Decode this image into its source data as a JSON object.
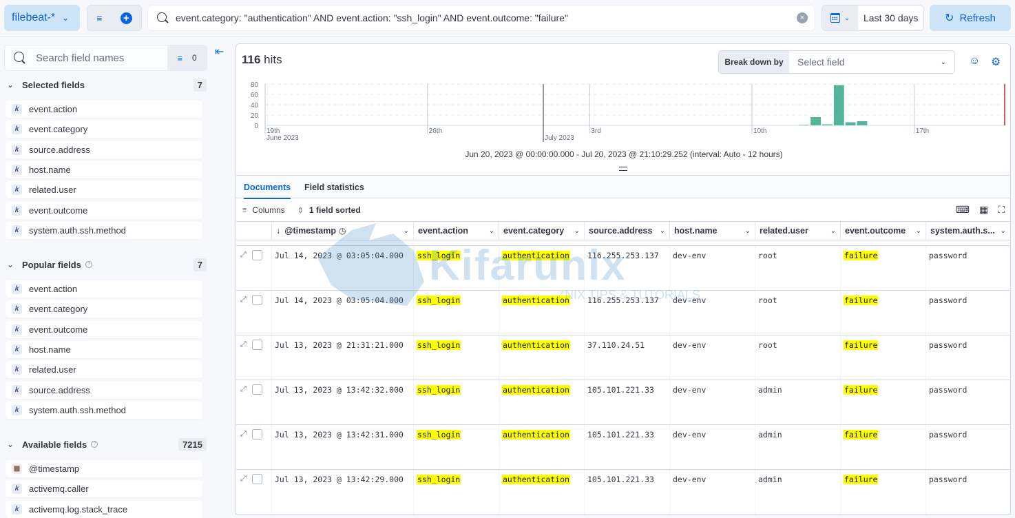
{
  "topbar": {
    "data_view": "filebeat-*",
    "query": "event.category: \"authentication\" AND event.action: \"ssh_login\" AND event.outcome: \"failure\"",
    "time_range_label": "Last 30 days",
    "refresh_label": "Refresh"
  },
  "sidebar": {
    "search_placeholder": "Search field names",
    "filter_count": "0",
    "selected": {
      "title": "Selected fields",
      "count": "7",
      "items": [
        {
          "type": "k",
          "name": "event.action"
        },
        {
          "type": "k",
          "name": "event.category"
        },
        {
          "type": "k",
          "name": "source.address"
        },
        {
          "type": "k",
          "name": "host.name"
        },
        {
          "type": "k",
          "name": "related.user"
        },
        {
          "type": "k",
          "name": "event.outcome"
        },
        {
          "type": "k",
          "name": "system.auth.ssh.method"
        }
      ]
    },
    "popular": {
      "title": "Popular fields",
      "count": "7",
      "items": [
        {
          "type": "k",
          "name": "event.action"
        },
        {
          "type": "k",
          "name": "event.category"
        },
        {
          "type": "k",
          "name": "event.outcome"
        },
        {
          "type": "k",
          "name": "host.name"
        },
        {
          "type": "k",
          "name": "related.user"
        },
        {
          "type": "k",
          "name": "source.address"
        },
        {
          "type": "k",
          "name": "system.auth.ssh.method"
        }
      ]
    },
    "available": {
      "title": "Available fields",
      "count": "7215",
      "items": [
        {
          "type": "date",
          "name": "@timestamp"
        },
        {
          "type": "k",
          "name": "activemq.caller"
        },
        {
          "type": "k",
          "name": "activemq.log.stack_trace"
        }
      ]
    }
  },
  "main": {
    "hits_count": "116",
    "hits_label": "hits",
    "breakdown_label": "Break down by",
    "breakdown_placeholder": "Select field",
    "time_range_text": "Jun 20, 2023 @ 00:00:00.000 - Jul 20, 2023 @ 21:10:29.252 (interval: Auto - 12 hours)",
    "tabs": [
      {
        "label": "Documents",
        "active": true
      },
      {
        "label": "Field statistics",
        "active": false
      }
    ],
    "columns_label": "Columns",
    "sorted_label": "1 field sorted"
  },
  "chart_data": {
    "type": "bar",
    "title": "",
    "xlabel": "",
    "ylabel": "",
    "ylim": [
      0,
      80
    ],
    "y_ticks": [
      "0",
      "20",
      "40",
      "60",
      "80"
    ],
    "x_tick_labels": [
      {
        "label": "19th",
        "sub": "June 2023"
      },
      {
        "label": "26th",
        "sub": ""
      },
      {
        "label": "",
        "sub": "July 2023"
      },
      {
        "label": "3rd",
        "sub": ""
      },
      {
        "label": "10th",
        "sub": ""
      },
      {
        "label": "17th",
        "sub": ""
      }
    ],
    "interval": "12 hours",
    "categories": [
      "Jul 12 00:00",
      "Jul 12 12:00",
      "Jul 13 00:00",
      "Jul 13 12:00",
      "Jul 14 00:00",
      "Jul 14 12:00"
    ],
    "values": [
      1,
      16,
      2,
      78,
      6,
      8
    ],
    "series_color": "#54b399",
    "grid": true,
    "legend": "none"
  },
  "table": {
    "headers": [
      "@timestamp",
      "event.action",
      "event.category",
      "source.address",
      "host.name",
      "related.user",
      "event.outcome",
      "system.auth.s..."
    ],
    "rows": [
      {
        "timestamp": "Jul 14, 2023 @ 03:05:04.000",
        "action": "ssh_login",
        "category": "authentication",
        "source": "116.255.253.137",
        "host": "dev-env",
        "user": "root",
        "outcome": "failure",
        "method": "password"
      },
      {
        "timestamp": "Jul 14, 2023 @ 03:05:04.000",
        "action": "ssh_login",
        "category": "authentication",
        "source": "116.255.253.137",
        "host": "dev-env",
        "user": "root",
        "outcome": "failure",
        "method": "password"
      },
      {
        "timestamp": "Jul 13, 2023 @ 21:31:21.000",
        "action": "ssh_login",
        "category": "authentication",
        "source": "37.110.24.51",
        "host": "dev-env",
        "user": "root",
        "outcome": "failure",
        "method": "password"
      },
      {
        "timestamp": "Jul 13, 2023 @ 13:42:32.000",
        "action": "ssh_login",
        "category": "authentication",
        "source": "105.101.221.33",
        "host": "dev-env",
        "user": " admin",
        "outcome": "failure",
        "method": "password"
      },
      {
        "timestamp": "Jul 13, 2023 @ 13:42:31.000",
        "action": "ssh_login",
        "category": "authentication",
        "source": "105.101.221.33",
        "host": "dev-env",
        "user": " admin",
        "outcome": "failure",
        "method": "password"
      },
      {
        "timestamp": "Jul 13, 2023 @ 13:42:29.000",
        "action": "ssh_login",
        "category": "authentication",
        "source": "105.101.221.33",
        "host": "dev-env",
        "user": " admin",
        "outcome": "failure",
        "method": "password"
      }
    ]
  },
  "watermark": {
    "title": "Kifarunix",
    "subtitle": "*NIX TIPS & TUTORIALS"
  }
}
